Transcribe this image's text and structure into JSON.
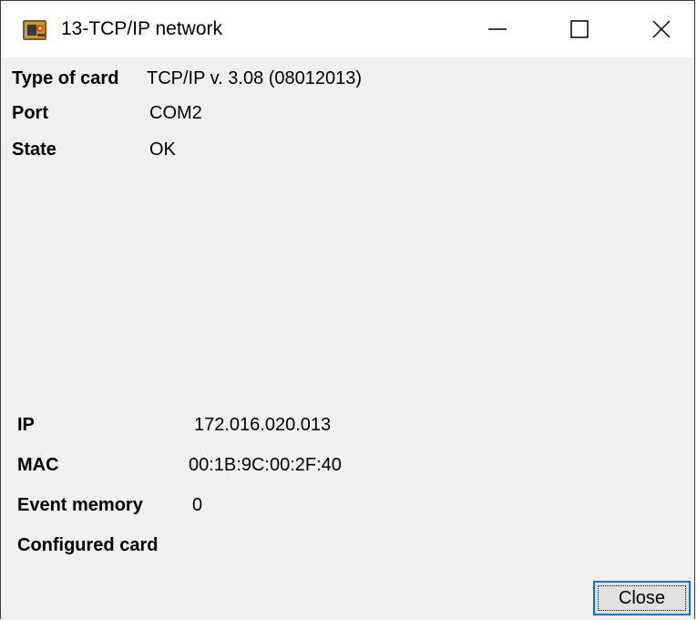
{
  "window": {
    "title": "13-TCP/IP network",
    "icon": "app-card-reader-icon",
    "controls": {
      "minimize": "minimize-icon",
      "maximize": "maximize-icon",
      "close": "close-icon"
    }
  },
  "info": {
    "type_of_card": {
      "label": "Type of card",
      "value": "TCP/IP v. 3.08 (08012013)"
    },
    "port": {
      "label": "Port",
      "value": "COM2"
    },
    "state": {
      "label": "State",
      "value": "OK"
    }
  },
  "network": {
    "ip": {
      "label": "IP",
      "value": "172.016.020.013"
    },
    "mac": {
      "label": "MAC",
      "value": "00:1B:9C:00:2F:40"
    },
    "event_memory": {
      "label": "Event memory",
      "value": "0"
    },
    "configured_card": {
      "label": "Configured card"
    }
  },
  "buttons": {
    "close": "Close"
  },
  "colors": {
    "title_bar": "#ffffff",
    "window_bg": "#f0f0f0",
    "button_bg": "#e1e1e1",
    "button_focus_border": "#0078d7"
  }
}
